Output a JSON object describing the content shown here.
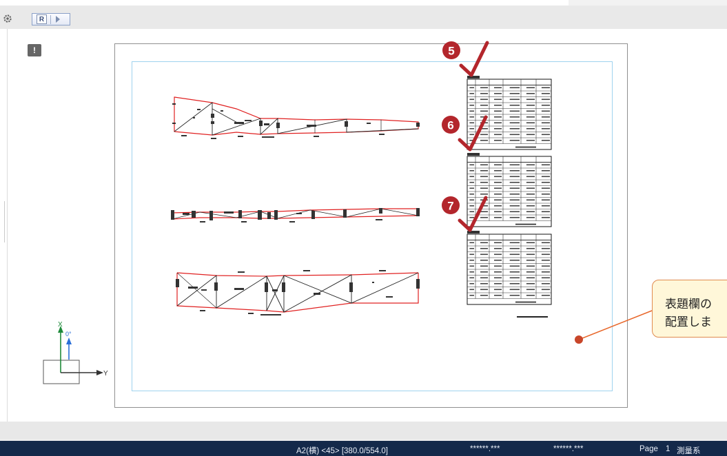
{
  "toolbar": {
    "r_label": "R"
  },
  "canvas": {
    "info_label": "!"
  },
  "steps": [
    {
      "number": "5"
    },
    {
      "number": "6"
    },
    {
      "number": "7"
    }
  ],
  "axis": {
    "x_label": "X",
    "y_label": "Y",
    "angle_label": "0°"
  },
  "callout": {
    "line1": "表題欄の",
    "line2": "配置しま"
  },
  "status": {
    "paper": "A2(横) <45> [380.0/554.0]",
    "coord1": "******.***",
    "coord2": "******.***",
    "page_label": "Page",
    "page_number": "1",
    "system": "測量系"
  },
  "colors": {
    "step_badge": "#b3262c",
    "check_mark": "#b3262c",
    "frame_inner": "#9fd2ee",
    "survey_line": "#e02020",
    "status_bg": "#14294a",
    "callout_bg": "#fff7d9",
    "callout_border": "#e08a4e",
    "leader_line": "#e8672a"
  }
}
